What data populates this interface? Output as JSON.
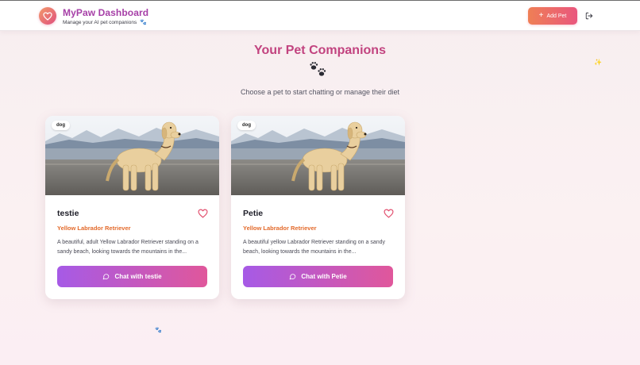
{
  "header": {
    "title": "MyPaw Dashboard",
    "subtitle": "Manage your AI pet companions",
    "subtitle_icon": "paw-icon",
    "add_pet_label": "Add Pet",
    "logout_icon": "logout-icon"
  },
  "main": {
    "title": "Your Pet Companions",
    "subtitle": "Choose a pet to start chatting or manage their diet"
  },
  "pets": [
    {
      "species": "dog",
      "name": "testie",
      "breed": "Yellow Labrador Retriever",
      "description": "A beautiful, adult Yellow Labrador Retriever standing on a sandy beach, looking towards the mountains in the...",
      "chat_label": "Chat with testie"
    },
    {
      "species": "dog",
      "name": "Petie",
      "breed": "Yellow Labrador Retriever",
      "description": "A beautiful yellow Labrador Retriever standing on a sandy beach, looking towards the mountains in the...",
      "chat_label": "Chat with Petie"
    }
  ],
  "colors": {
    "brand_title": "#a63fa7",
    "heading": "#c2437f",
    "breed": "#e36a2b",
    "add_button_start": "#ef7f55",
    "add_button_end": "#e9567e",
    "chat_button_start": "#a65ae6",
    "chat_button_end": "#e0579b"
  }
}
